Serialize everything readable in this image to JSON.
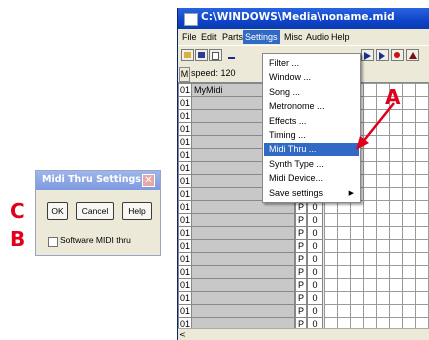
{
  "main_window": {
    "title": "C:\\WINDOWS\\Media\\noname.mid",
    "menu": [
      "File",
      "Edit",
      "Parts",
      "Settings",
      "Misc",
      "Audio",
      "Help"
    ],
    "active_menu": "Settings",
    "header": {
      "m_label": "M",
      "speed": "speed: 120"
    },
    "tracks": [
      {
        "num": "01",
        "name": "MyMidi",
        "p": "",
        "z": ""
      },
      {
        "num": "01",
        "name": "",
        "p": "",
        "z": ""
      },
      {
        "num": "01",
        "name": "",
        "p": "",
        "z": ""
      },
      {
        "num": "01",
        "name": "",
        "p": "",
        "z": ""
      },
      {
        "num": "01",
        "name": "",
        "p": "",
        "z": ""
      },
      {
        "num": "01",
        "name": "",
        "p": "",
        "z": ""
      },
      {
        "num": "01",
        "name": "",
        "p": "",
        "z": ""
      },
      {
        "num": "01",
        "name": "",
        "p": "P",
        "z": "0"
      },
      {
        "num": "01",
        "name": "",
        "p": "P",
        "z": "0"
      },
      {
        "num": "01",
        "name": "",
        "p": "P",
        "z": "0"
      },
      {
        "num": "01",
        "name": "",
        "p": "P",
        "z": "0"
      },
      {
        "num": "01",
        "name": "",
        "p": "P",
        "z": "0"
      },
      {
        "num": "01",
        "name": "",
        "p": "P",
        "z": "0"
      },
      {
        "num": "01",
        "name": "",
        "p": "P",
        "z": "0"
      },
      {
        "num": "01",
        "name": "",
        "p": "P",
        "z": "0"
      },
      {
        "num": "01",
        "name": "",
        "p": "P",
        "z": "0"
      },
      {
        "num": "01",
        "name": "",
        "p": "P",
        "z": "0"
      },
      {
        "num": "01",
        "name": "",
        "p": "P",
        "z": "0"
      },
      {
        "num": "01",
        "name": "",
        "p": "P",
        "z": "0"
      }
    ],
    "scroll_left_glyph": "<"
  },
  "settings_menu": {
    "items": [
      "Filter ...",
      "Window ...",
      "Song ...",
      "Metronome ...",
      "Effects ...",
      "Timing ...",
      "Midi Thru ...",
      "Synth Type ...",
      "Midi Device...",
      "Save settings"
    ],
    "highlighted": "Midi Thru ...",
    "submenu_arrow": "▶"
  },
  "dialog": {
    "title": "Midi Thru Settings",
    "close_glyph": "✕",
    "buttons": {
      "ok": "OK",
      "cancel": "Cancel",
      "help": "Help"
    },
    "checkbox_label": "Software MIDI thru",
    "checkbox_checked": false
  },
  "annotations": {
    "a": "A",
    "b": "B",
    "c": "C"
  },
  "colors": {
    "annotation_red": "#e0001b",
    "highlight_blue": "#316ac5",
    "title_blue": "#0e44c8"
  }
}
